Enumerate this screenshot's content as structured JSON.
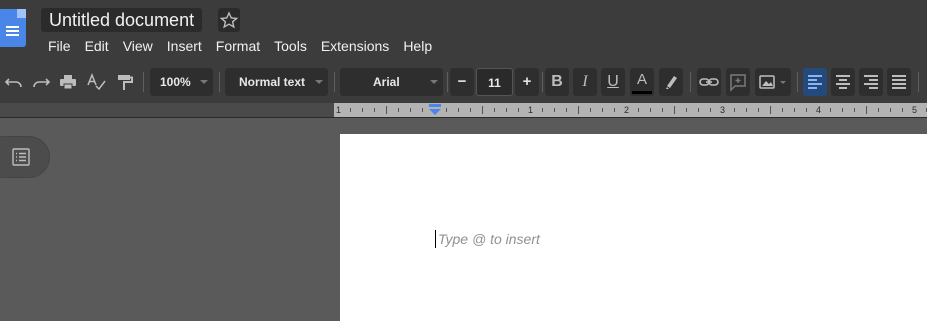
{
  "document": {
    "title": "Untitled document"
  },
  "menu": {
    "items": [
      "File",
      "Edit",
      "View",
      "Insert",
      "Format",
      "Tools",
      "Extensions",
      "Help"
    ]
  },
  "toolbar": {
    "zoom": "100%",
    "style": "Normal text",
    "font": "Arial",
    "font_size": "11",
    "decrease_size": "−",
    "increase_size": "+",
    "bold": "B",
    "italic": "I",
    "underline": "U",
    "text_color_glyph": "A",
    "icons": [
      "undo-icon",
      "redo-icon",
      "print-icon",
      "spellcheck-icon",
      "paint-format-icon",
      "insert-link-icon",
      "add-comment-icon",
      "insert-image-icon",
      "align-left-icon",
      "align-center-icon",
      "align-right-icon",
      "align-justify-icon"
    ],
    "active_alignment": "left"
  },
  "ruler": {
    "numbers": [
      "1",
      "1",
      "2",
      "3",
      "4",
      "5"
    ]
  },
  "editor": {
    "placeholder": "Type @ to insert"
  },
  "colors": {
    "chrome": "#3c3c3c",
    "canvas": "#5a5a5a",
    "page": "#ffffff",
    "accent": "#4a86e8",
    "active_button": "#234a7a"
  }
}
